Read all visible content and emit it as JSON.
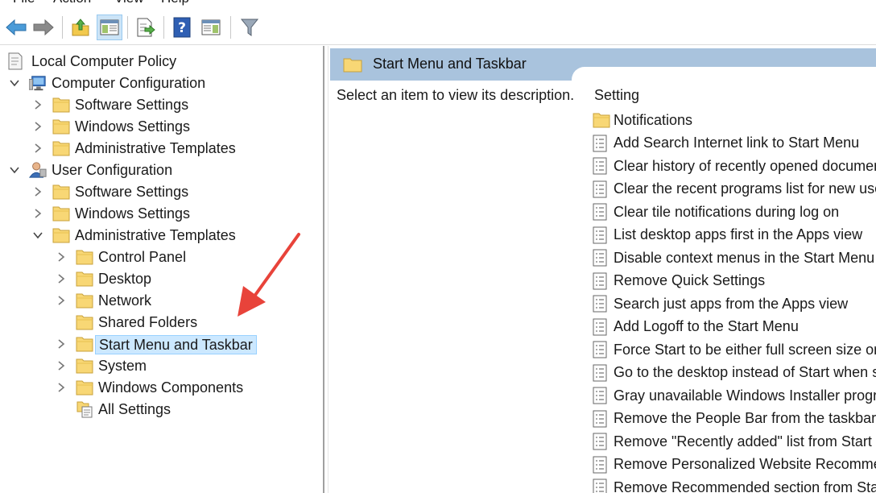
{
  "menu": [
    "File",
    "Action",
    "View",
    "Help"
  ],
  "toolbar": {
    "buttons": [
      {
        "icon": "back-arrow-icon"
      },
      {
        "icon": "forward-arrow-icon"
      },
      {
        "icon": "up-folder-icon"
      },
      {
        "icon": "show-hide-tree-icon"
      },
      {
        "icon": "export-list-icon"
      },
      {
        "icon": "help-icon"
      },
      {
        "icon": "extended-view-icon"
      },
      {
        "icon": "filter-icon"
      }
    ]
  },
  "tree": {
    "root": "Local Computer Policy",
    "items": [
      {
        "label": "Computer Configuration"
      },
      {
        "label": "Software Settings"
      },
      {
        "label": "Windows Settings"
      },
      {
        "label": "Administrative Templates"
      },
      {
        "label": "User Configuration"
      },
      {
        "label": "Software Settings"
      },
      {
        "label": "Windows Settings"
      },
      {
        "label": "Administrative Templates"
      },
      {
        "label": "Control Panel"
      },
      {
        "label": "Desktop"
      },
      {
        "label": "Network"
      },
      {
        "label": "Shared Folders"
      },
      {
        "label": "Start Menu and Taskbar"
      },
      {
        "label": "System"
      },
      {
        "label": "Windows Components"
      },
      {
        "label": "All Settings"
      }
    ]
  },
  "details": {
    "title": "Start Menu and Taskbar",
    "description": "Select an item to view its description.",
    "column_header": "Setting",
    "settings": [
      {
        "label": "Notifications",
        "icon": "folder-icon"
      },
      {
        "label": "Add Search Internet link to Start Menu",
        "icon": "policy-setting-icon"
      },
      {
        "label": "Clear history of recently opened documen",
        "icon": "policy-setting-icon"
      },
      {
        "label": "Clear the recent programs list for new user",
        "icon": "policy-setting-icon"
      },
      {
        "label": "Clear tile notifications during log on",
        "icon": "policy-setting-icon"
      },
      {
        "label": "List desktop apps first in the Apps view",
        "icon": "policy-setting-icon"
      },
      {
        "label": "Disable context menus in the Start Menu",
        "icon": "policy-setting-icon"
      },
      {
        "label": "Remove Quick Settings",
        "icon": "policy-setting-icon"
      },
      {
        "label": "Search just apps from the Apps view",
        "icon": "policy-setting-icon"
      },
      {
        "label": "Add Logoff to the Start Menu",
        "icon": "policy-setting-icon"
      },
      {
        "label": "Force Start to be either full screen size or m",
        "icon": "policy-setting-icon"
      },
      {
        "label": "Go to the desktop instead of Start when si",
        "icon": "policy-setting-icon"
      },
      {
        "label": "Gray unavailable Windows Installer progra",
        "icon": "policy-setting-icon"
      },
      {
        "label": "Remove the People Bar from the taskbar",
        "icon": "policy-setting-icon"
      },
      {
        "label": "Remove \"Recently added\" list from Start M",
        "icon": "policy-setting-icon"
      },
      {
        "label": "Remove Personalized Website Recommenc",
        "icon": "policy-setting-icon"
      },
      {
        "label": "Remove Recommended section from Start",
        "icon": "policy-setting-icon"
      }
    ]
  },
  "colors": {
    "header_bg": "#a9c3dd",
    "selection_bg": "#cce8ff",
    "annotation_arrow": "#e8433a",
    "folder_fill": "#f8d775"
  }
}
